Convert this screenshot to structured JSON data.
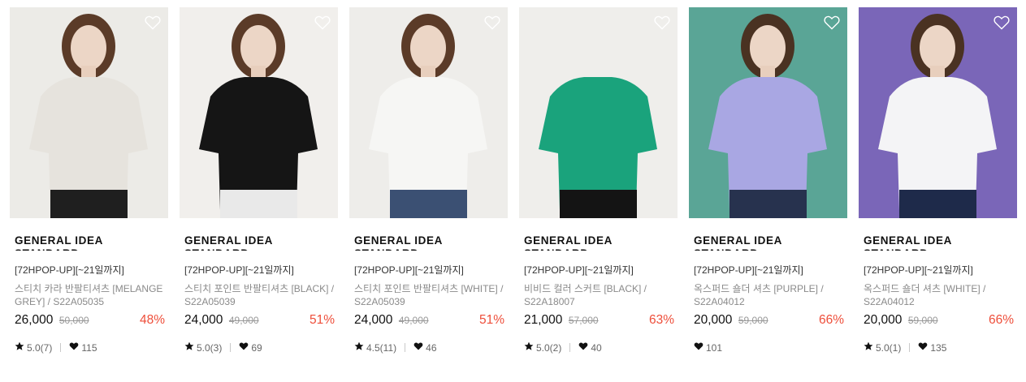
{
  "products": [
    {
      "brand": "GENERAL IDEA STANDARD",
      "promo": "[72HPOP-UP][~21일까지]",
      "name": "스티치 카라 반팔티셔츠 [MELANGE GREY] / S22A05035",
      "price": "26,000",
      "original_price": "50,000",
      "discount": "48%",
      "rating": "5.0(7)",
      "likes": "115",
      "photo": {
        "bg": "#ecebe7",
        "shirt": "#e6e3dd",
        "bottom": "#1f1f1f",
        "hair": "#5b3b28"
      }
    },
    {
      "brand": "GENERAL IDEA STANDARD",
      "promo": "[72HPOP-UP][~21일까지]",
      "name": "스티치 포인트 반팔티셔츠 [BLACK] / S22A05039",
      "price": "24,000",
      "original_price": "49,000",
      "discount": "51%",
      "rating": "5.0(3)",
      "likes": "69",
      "photo": {
        "bg": "#f1efec",
        "shirt": "#151515",
        "bottom": "#e9e9e9",
        "hair": "#5b3b28"
      }
    },
    {
      "brand": "GENERAL IDEA STANDARD",
      "promo": "[72HPOP-UP][~21일까지]",
      "name": "스티치 포인트 반팔티셔츠 [WHITE] / S22A05039",
      "price": "24,000",
      "original_price": "49,000",
      "discount": "51%",
      "rating": "4.5(11)",
      "likes": "46",
      "photo": {
        "bg": "#eeedea",
        "shirt": "#f6f6f4",
        "bottom": "#3b5073",
        "hair": "#5b3b28"
      }
    },
    {
      "brand": "GENERAL IDEA STANDARD",
      "promo": "[72HPOP-UP][~21일까지]",
      "name": "비비드 컬러 스커트 [BLACK] / S22A18007",
      "price": "21,000",
      "original_price": "57,000",
      "discount": "63%",
      "rating": "5.0(2)",
      "likes": "40",
      "photo": {
        "bg": "#efeeeb",
        "shirt": "#1aa37c",
        "bottom": "#141414",
        "hair": ""
      }
    },
    {
      "brand": "GENERAL IDEA STANDARD",
      "promo": "[72HPOP-UP][~21일까지]",
      "name": "옥스퍼드 숄더 셔츠 [PURPLE] / S22A04012",
      "price": "20,000",
      "original_price": "59,000",
      "discount": "66%",
      "rating": "",
      "likes": "101",
      "photo": {
        "bg": "#5aa596",
        "shirt": "#a9a7e3",
        "bottom": "#27324e",
        "hair": "#4a3222"
      }
    },
    {
      "brand": "GENERAL IDEA STANDARD",
      "promo": "[72HPOP-UP][~21일까지]",
      "name": "옥스퍼드 숄더 셔츠 [WHITE] / S22A04012",
      "price": "20,000",
      "original_price": "59,000",
      "discount": "66%",
      "rating": "5.0(1)",
      "likes": "135",
      "photo": {
        "bg": "#7a66b8",
        "shirt": "#f4f4f6",
        "bottom": "#1e2a4a",
        "hair": "#4a3222"
      }
    }
  ]
}
